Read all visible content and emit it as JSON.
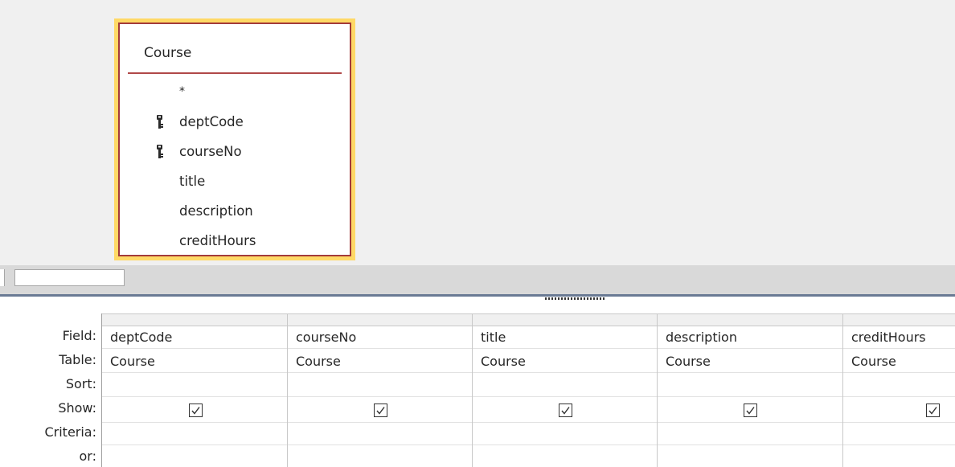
{
  "table": {
    "title": "Course",
    "fields": [
      {
        "name": "*",
        "key": false
      },
      {
        "name": "deptCode",
        "key": true
      },
      {
        "name": "courseNo",
        "key": true
      },
      {
        "name": "title",
        "key": false
      },
      {
        "name": "description",
        "key": false
      },
      {
        "name": "creditHours",
        "key": false
      }
    ]
  },
  "grid": {
    "row_labels": [
      "Field:",
      "Table:",
      "Sort:",
      "Show:",
      "Criteria:",
      "or:"
    ],
    "columns": [
      {
        "field": "deptCode",
        "table": "Course",
        "show": true
      },
      {
        "field": "courseNo",
        "table": "Course",
        "show": true
      },
      {
        "field": "title",
        "table": "Course",
        "show": true
      },
      {
        "field": "description",
        "table": "Course",
        "show": true
      },
      {
        "field": "creditHours",
        "table": "Course",
        "show": true
      }
    ]
  },
  "colors": {
    "table_highlight": "#ffd966",
    "table_border": "#a33a3a",
    "pane_background": "#f0f0f0"
  }
}
